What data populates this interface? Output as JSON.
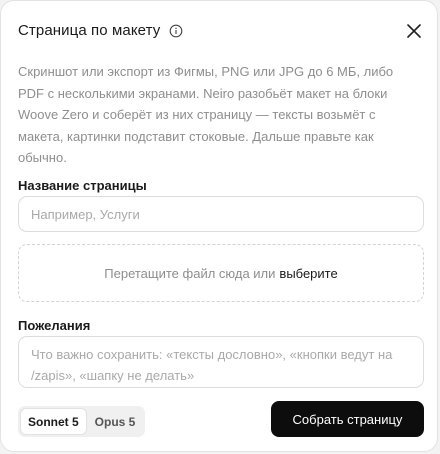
{
  "dialog": {
    "title": "Страница по макету",
    "description": "Скриншот или экспорт из Фигмы, PNG или JPG до 6 МБ, либо PDF с несколькими экранами. Neiro разобьёт макет на блоки Woove Zero и соберёт из них страницу — тексты возьмёт с макета, картинки подставит стоковые. Дальше правьте как обычно."
  },
  "page_name": {
    "label": "Название страницы",
    "value": "",
    "placeholder": "Например, Услуги"
  },
  "upload": {
    "text": "Перетащите файл сюда или",
    "link": "выберите"
  },
  "wishes": {
    "label": "Пожелания",
    "value": "",
    "placeholder": "Что важно сохранить: «тексты дословно», «кнопки ведут на /zapis», «шапку не делать»"
  },
  "models": {
    "options": [
      "Sonnet 5",
      "Opus 5"
    ],
    "selected": "Sonnet 5"
  },
  "actions": {
    "submit_label": "Собрать страницу"
  },
  "icons": {
    "info": "info-icon",
    "close": "close-icon"
  }
}
